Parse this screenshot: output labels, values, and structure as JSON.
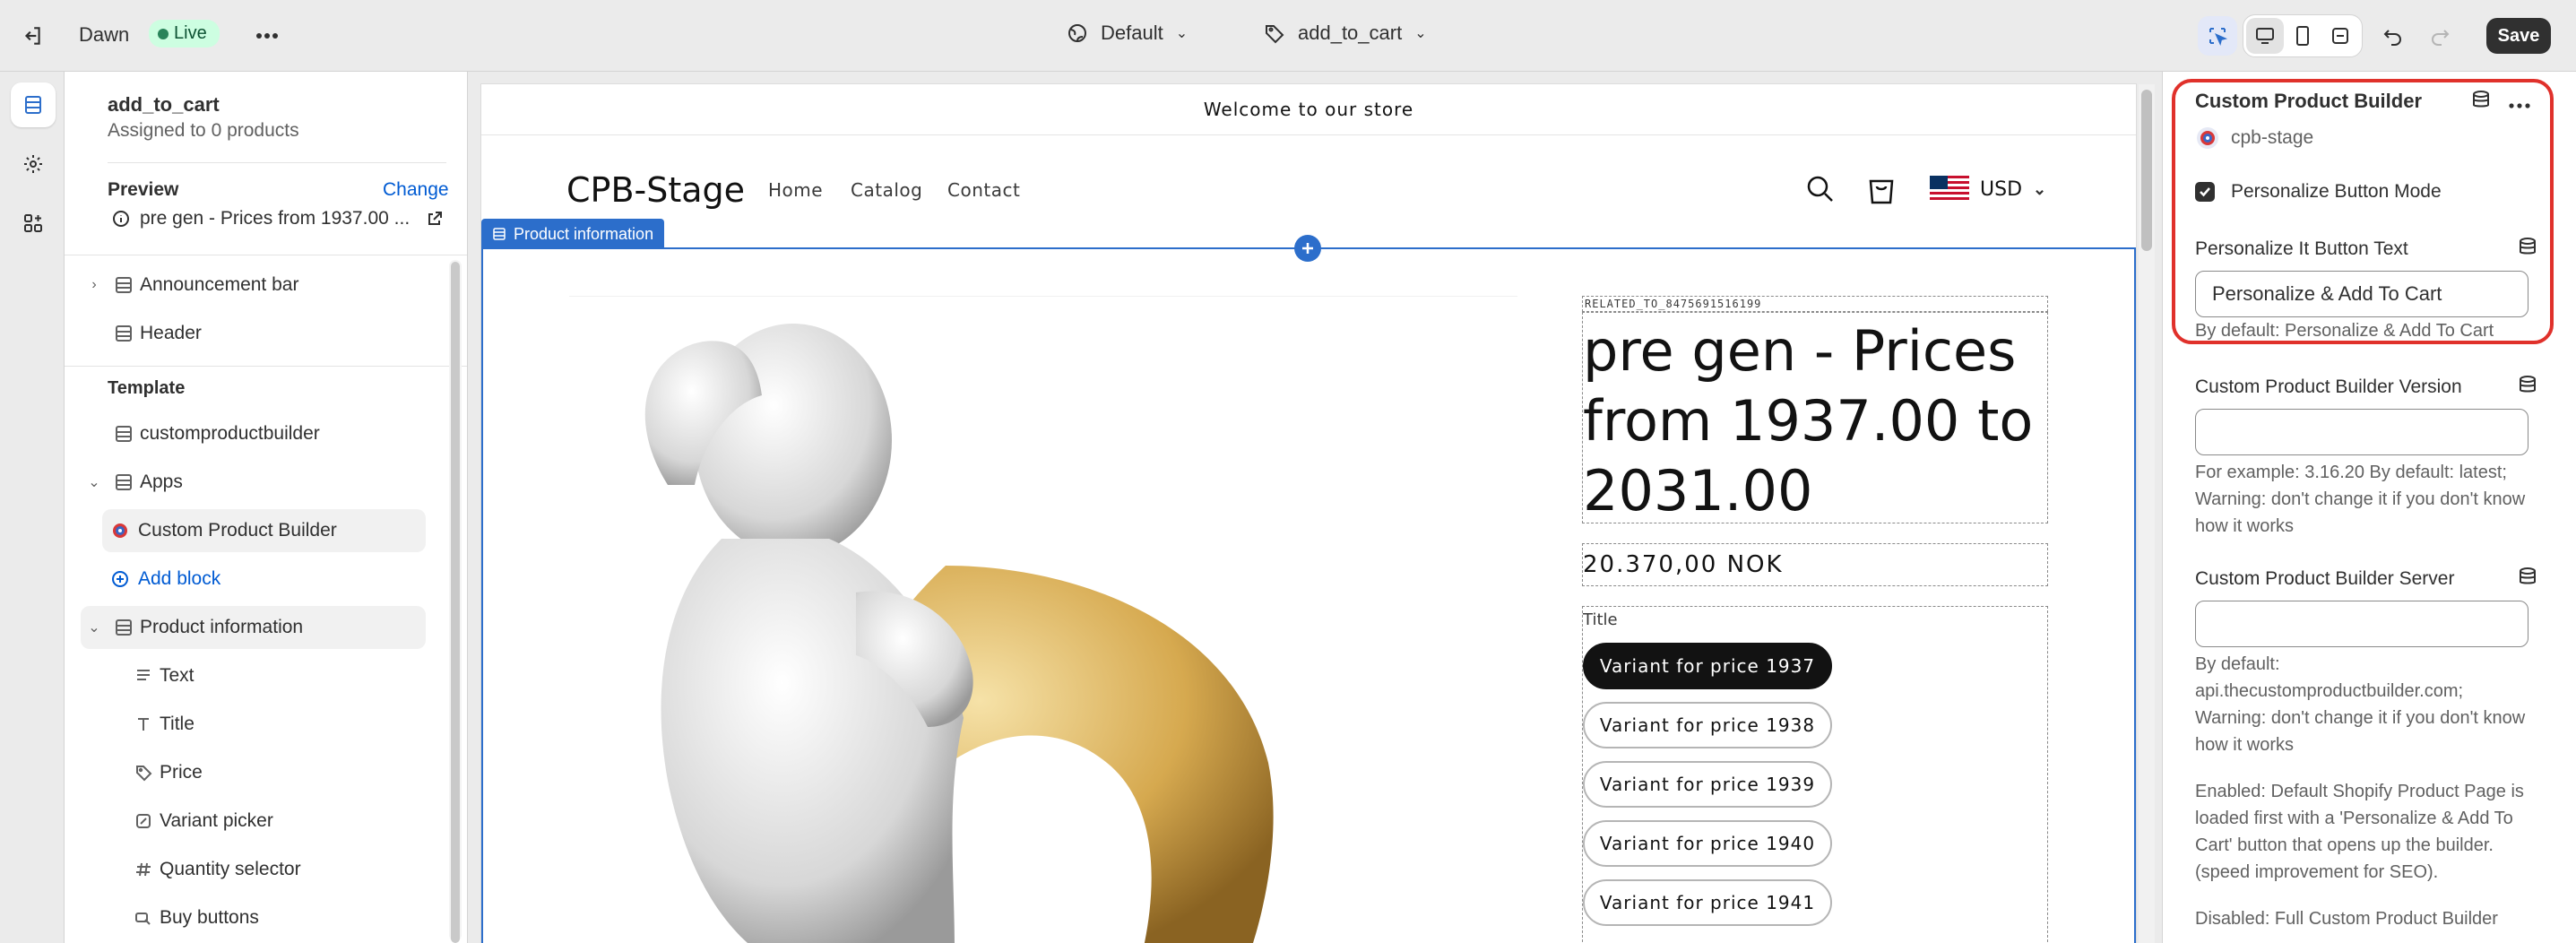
{
  "topbar": {
    "theme_name": "Dawn",
    "live_label": "Live",
    "default_label": "Default",
    "template_label": "add_to_cart",
    "save_label": "Save"
  },
  "sidebar": {
    "template_name": "add_to_cart",
    "assigned": "Assigned to 0 products",
    "preview_label": "Preview",
    "change_label": "Change",
    "preview_product": "pre gen - Prices from 1937.00 ...",
    "items": [
      {
        "label": "Announcement bar"
      },
      {
        "label": "Header"
      },
      {
        "label": "Template"
      },
      {
        "label": "customproductbuilder"
      },
      {
        "label": "Apps"
      },
      {
        "label": "Custom Product Builder"
      },
      {
        "label": "Add block"
      },
      {
        "label": "Product information"
      },
      {
        "label": "Text"
      },
      {
        "label": "Title"
      },
      {
        "label": "Price"
      },
      {
        "label": "Variant picker"
      },
      {
        "label": "Quantity selector"
      },
      {
        "label": "Buy buttons"
      }
    ]
  },
  "store": {
    "announcement": "Welcome to our store",
    "logo": "CPB-Stage",
    "nav": [
      "Home",
      "Catalog",
      "Contact"
    ],
    "currency": "USD",
    "section_tag": "Product information",
    "related_text": "RELATED_TO_8475691516199",
    "product_title": "pre gen - Prices from 1937.00 to 2031.00",
    "price": "20.370,00 NOK",
    "variant_label": "Title",
    "variants": [
      "Variant for price 1937",
      "Variant for price 1938",
      "Variant for price 1939",
      "Variant for price 1940",
      "Variant for price 1941"
    ]
  },
  "panel": {
    "title": "Custom Product Builder",
    "app_name": "cpb-stage",
    "checkbox_label": "Personalize Button Mode",
    "button_text_label": "Personalize It Button Text",
    "button_text_value": "Personalize & Add To Cart",
    "button_text_help": "By default: Personalize & Add To Cart",
    "version_label": "Custom Product Builder Version",
    "version_value": "",
    "version_help": "For example: 3.16.20 By default: latest; Warning: don't change it if you don't know how it works",
    "server_label": "Custom Product Builder Server",
    "server_value": "",
    "server_help": "By default: api.thecustomproductbuilder.com; Warning: don't change it if you don't know how it works",
    "enabled_help": "Enabled: Default Shopify Product Page is loaded first with a 'Personalize & Add To Cart' button that opens up the builder. (speed improvement for SEO).",
    "disabled_help": "Disabled: Full Custom Product Builder"
  },
  "colors": {
    "accent": "#2c6ecb",
    "highlight": "#e0312b",
    "live_badge": "#cdfee1"
  }
}
